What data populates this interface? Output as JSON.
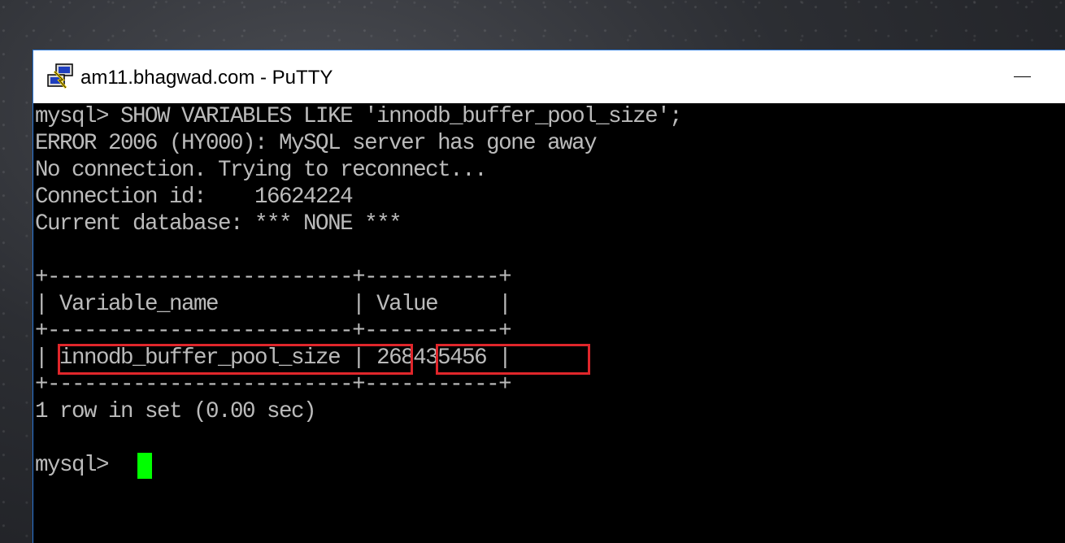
{
  "window": {
    "title": "am11.bhagwad.com - PuTTY",
    "icon": "putty-icon",
    "minimize_icon": "minimize-icon"
  },
  "terminal": {
    "lines": [
      "mysql> SHOW VARIABLES LIKE 'innodb_buffer_pool_size';",
      "ERROR 2006 (HY000): MySQL server has gone away",
      "No connection. Trying to reconnect...",
      "Connection id:    16624224",
      "Current database: *** NONE ***",
      "",
      "+-------------------------+-----------+",
      "| Variable_name           | Value     |",
      "+-------------------------+-----------+",
      "| innodb_buffer_pool_size | 268435456 |",
      "+-------------------------+-----------+",
      "1 row in set (0.00 sec)",
      "",
      "mysql> "
    ],
    "highlighted_variable": "innodb_buffer_pool_size",
    "highlighted_value": "268435456"
  },
  "colors": {
    "terminal_bg": "#000000",
    "terminal_fg": "#bbbbbb",
    "cursor": "#00ff00",
    "highlight_border": "#e0262b",
    "window_border": "#2b78d8"
  }
}
